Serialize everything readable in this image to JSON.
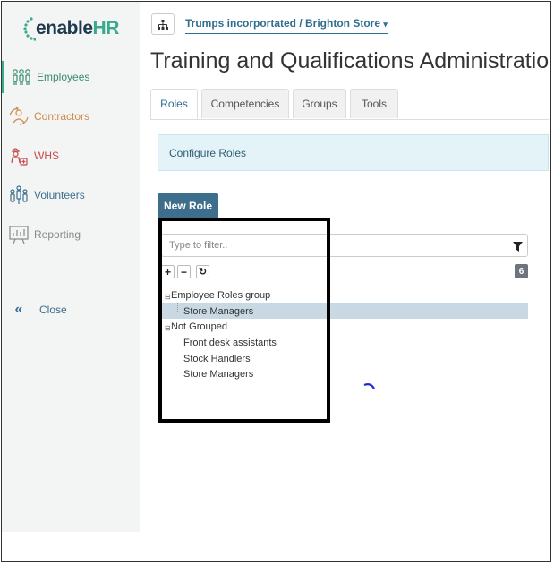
{
  "sidebar": {
    "logo": {
      "enable": "enable",
      "hr": "HR"
    },
    "items": [
      {
        "label": "Employees",
        "icon": "employees-icon",
        "color": "#3a8c6e"
      },
      {
        "label": "Contractors",
        "icon": "contractors-icon",
        "color": "#d08a4a"
      },
      {
        "label": "WHS",
        "icon": "whs-icon",
        "color": "#c84b4b"
      },
      {
        "label": "Volunteers",
        "icon": "volunteers-icon",
        "color": "#3d6f8c"
      },
      {
        "label": "Reporting",
        "icon": "reporting-icon",
        "color": "#888888"
      },
      {
        "label": "Close",
        "icon": "double-chevron-left-icon",
        "color": "#3d6f8c"
      }
    ]
  },
  "header": {
    "breadcrumb": "Trumps incorportated / Brighton Store",
    "title": "Training and Qualifications Administration"
  },
  "tabs": [
    {
      "label": "Roles",
      "active": true
    },
    {
      "label": "Competencies",
      "active": false
    },
    {
      "label": "Groups",
      "active": false
    },
    {
      "label": "Tools",
      "active": false
    }
  ],
  "info_box": {
    "text": "Configure Roles"
  },
  "new_role_button": "New Role",
  "filter": {
    "placeholder": "Type to filter.."
  },
  "tree_controls": {
    "expand": "+",
    "collapse": "−",
    "refresh": "↻"
  },
  "count": "6",
  "tree": {
    "group1": {
      "label": "Employee Roles group",
      "children": [
        "Store Managers"
      ]
    },
    "group2": {
      "label": "Not Grouped",
      "children": [
        "Front desk assistants",
        "Stock Handlers",
        "Store Managers"
      ]
    }
  },
  "colors": {
    "accent": "#3d6f8c",
    "brand": "#3aaa8c",
    "selected_row": "#c8d9e4",
    "info_bg": "#e3f3f8"
  }
}
